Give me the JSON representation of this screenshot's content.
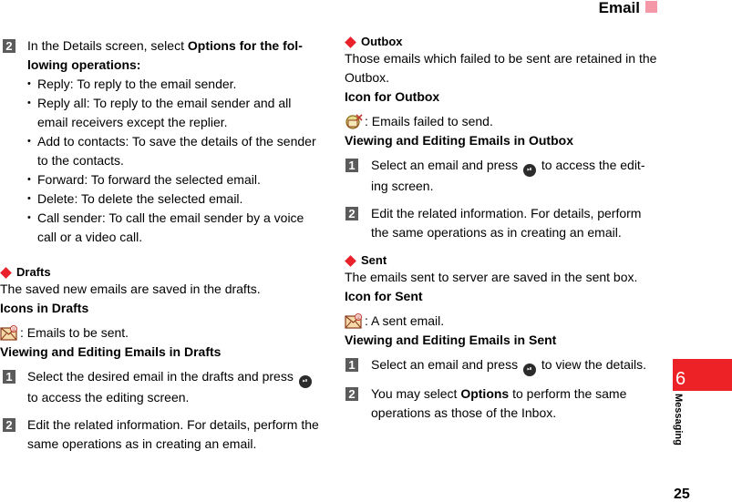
{
  "header": {
    "title": "Email",
    "accent_color": "#f497a6"
  },
  "sidebar": {
    "chapter_number": "6",
    "chapter_label": "Messaging",
    "tab_color": "#ec2227"
  },
  "footer": {
    "page_number": "25"
  },
  "left_column": {
    "options_step": {
      "number": "2",
      "text_before": "In the Details screen, select ",
      "text_bold": "Options for the fol-lowing operations:",
      "bullets": [
        "Reply: To reply to the email sender.",
        "Reply all: To reply to the email sender and all email receivers except the replier.",
        "Add to contacts: To save the details of the sender to the contacts.",
        "Forward: To forward the selected email.",
        "Delete: To delete the selected email.",
        "Call sender: To call the email sender by a voice call or a video call."
      ]
    },
    "drafts": {
      "heading": "Drafts",
      "description": "The saved new emails are saved in the drafts.",
      "icons_heading": "Icons in Drafts",
      "icon_name": "draft-email-icon",
      "icon_text": ": Emails to be sent.",
      "viewing_heading": "Viewing and Editing Emails in Drafts",
      "steps": [
        {
          "number": "1",
          "text_before": "Select the desired email in the drafts and press ",
          "icon": "ok-key-icon",
          "text_after": " to access the editing screen."
        },
        {
          "number": "2",
          "text_before": "Edit the related information. For details, perform the same operations as in creating an email.",
          "text_after": ""
        }
      ]
    }
  },
  "right_column": {
    "outbox": {
      "heading": "Outbox",
      "description": "Those emails which failed to be sent are retained in the Outbox.",
      "icons_heading": "Icon for Outbox",
      "icon_name": "failed-email-icon",
      "icon_text": ": Emails failed to send.",
      "viewing_heading": "Viewing and Editing Emails in Outbox",
      "steps": [
        {
          "number": "1",
          "text_before": "Select an email and press ",
          "icon": "ok-key-icon",
          "text_after": " to access the edit-ing screen."
        },
        {
          "number": "2",
          "text_before": "Edit the related information. For details, perform the same operations as in creating an email.",
          "text_after": ""
        }
      ]
    },
    "sent": {
      "heading": "Sent",
      "description": "The emails sent to server are saved in the sent box.",
      "icons_heading": "Icon for Sent",
      "icon_name": "sent-email-icon",
      "icon_text": ": A sent email.",
      "viewing_heading": "Viewing and Editing Emails in Sent",
      "steps": [
        {
          "number": "1",
          "text_before": "Select an email and press ",
          "icon": "ok-key-icon",
          "text_after": " to view the details."
        },
        {
          "number": "2",
          "text_before": "You may select ",
          "text_bold": "Options",
          "text_after": " to perform the same operations as those of the Inbox."
        }
      ]
    }
  },
  "ok_key_glyph": "⏯"
}
